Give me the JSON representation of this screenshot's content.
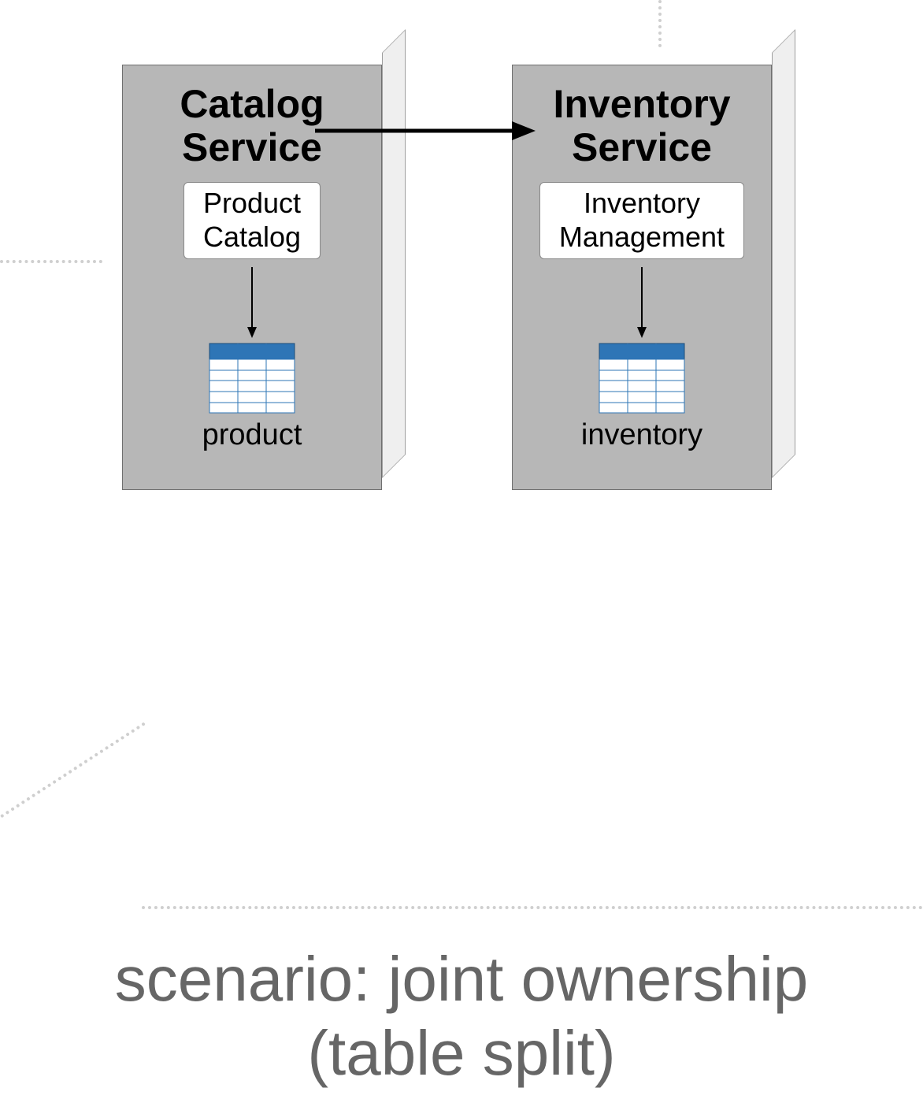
{
  "left_block": {
    "title_line1": "Catalog",
    "title_line2": "Service",
    "sub_line1": "Product",
    "sub_line2": "Catalog",
    "table_label": "product"
  },
  "right_block": {
    "title_line1": "Inventory",
    "title_line2": "Service",
    "sub_line1": "Inventory",
    "sub_line2": "Management",
    "table_label": "inventory"
  },
  "caption_line1": "scenario: joint ownership",
  "caption_line2": "(table split)",
  "icons": {
    "database": "database-table-icon",
    "arrow_down": "arrow-down-icon",
    "arrow_right": "arrow-right-icon"
  }
}
